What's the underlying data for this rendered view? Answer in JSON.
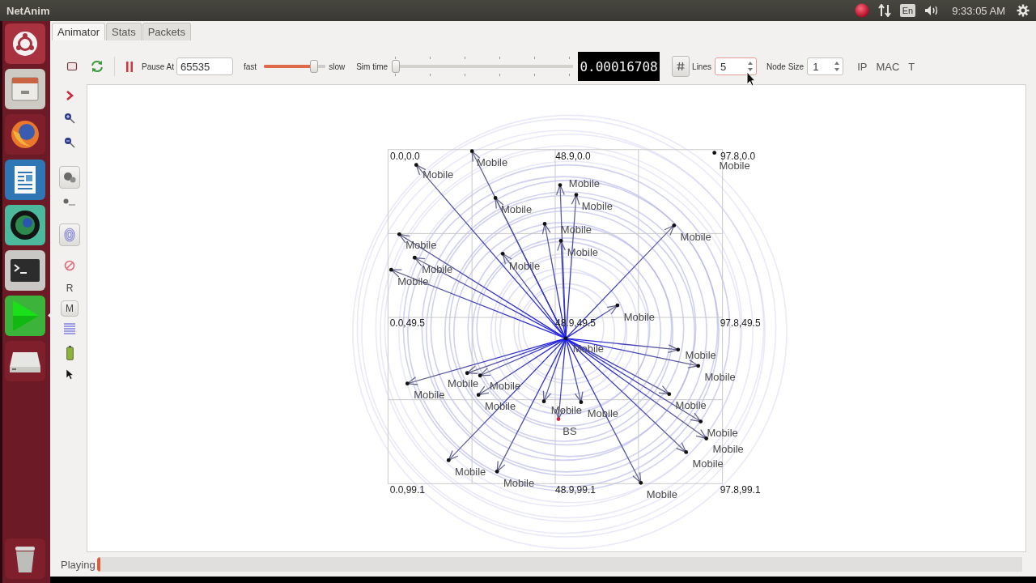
{
  "top_bar": {
    "title": "NetAnim",
    "keyboard": "En",
    "clock": "9:33:05 AM"
  },
  "launcher": [
    {
      "kind": "dash",
      "focused": false
    },
    {
      "kind": "files",
      "focused": false
    },
    {
      "kind": "browser",
      "focused": false
    },
    {
      "kind": "writer",
      "focused": false
    },
    {
      "kind": "sphere",
      "focused": false
    },
    {
      "kind": "terminal",
      "focused": false
    },
    {
      "kind": "player",
      "focused": true
    },
    {
      "kind": "drive",
      "focused": false
    },
    {
      "kind": "trash",
      "focused": false
    }
  ],
  "tabs": [
    {
      "label": "Animator",
      "selected": true
    },
    {
      "label": "Stats",
      "selected": false
    },
    {
      "label": "Packets",
      "selected": false
    }
  ],
  "toolbar": {
    "pause_at_label": "Pause At",
    "pause_at": "65535",
    "fast_label": "fast",
    "speed": {
      "level": 0.82
    },
    "slow_label": "slow",
    "sim_time_label": "Sim time",
    "sim_time": {
      "level": 0.02
    },
    "lcd": "0.00016708",
    "lines_label": "Lines",
    "lines": "5",
    "node_size_label": "Node Size",
    "node_size": "1",
    "buttons": [
      "IP",
      "MAC",
      "T"
    ]
  },
  "side_tools": [
    {
      "kind": "chevron"
    },
    {
      "kind": "zoom_in"
    },
    {
      "kind": "zoom_out"
    },
    {
      "kind": "node_tile"
    },
    {
      "kind": "node_small"
    },
    {
      "kind": "fingerprint_tile"
    },
    {
      "kind": "prohibited"
    },
    {
      "kind": "text",
      "label": "R"
    },
    {
      "kind": "text_tile",
      "label": "M"
    },
    {
      "kind": "lines"
    },
    {
      "kind": "battery"
    },
    {
      "kind": "pointer"
    }
  ],
  "canvas": {
    "grid_labels": [
      "0.0,0.0",
      "48.9,0.0",
      "97.8,0.0",
      "0.0,49.5",
      "48.9,49.5",
      "97.8,49.5",
      "0.0,99.1",
      "48.9,99.1",
      "97.8,99.1"
    ],
    "nodes": [
      {
        "label": "Mobile",
        "kind": "linked",
        "color": "#111111"
      },
      {
        "label": "Mobile",
        "kind": "plain",
        "color": "#111111"
      },
      {
        "label": "Mobile",
        "kind": "linked",
        "color": "#111111"
      },
      {
        "label": "Mobile",
        "kind": "linked",
        "color": "#111111"
      },
      {
        "label": "Mobile",
        "kind": "linked",
        "color": "#111111"
      },
      {
        "label": "Mobile",
        "kind": "linked",
        "color": "#111111"
      },
      {
        "label": "Mobile",
        "kind": "linked",
        "color": "#111111"
      },
      {
        "label": "Mobile",
        "kind": "linked",
        "color": "#111111"
      },
      {
        "label": "Mobile",
        "kind": "linked",
        "color": "#111111"
      },
      {
        "label": "Mobile",
        "kind": "linked",
        "color": "#111111"
      },
      {
        "label": "Mobile",
        "kind": "linked",
        "color": "#111111"
      },
      {
        "label": "Mobile",
        "kind": "linked",
        "color": "#111111"
      },
      {
        "label": "Mobile",
        "kind": "linked",
        "color": "#111111"
      },
      {
        "label": "Mobile",
        "kind": "linked",
        "color": "#111111"
      },
      {
        "label": "Mobile",
        "kind": "plain",
        "color": "#111111"
      },
      {
        "label": "Mobile",
        "kind": "linked",
        "color": "#111111"
      },
      {
        "label": "Mobile",
        "kind": "linked",
        "color": "#111111"
      },
      {
        "label": "Mobile",
        "kind": "linked",
        "color": "#111111"
      },
      {
        "label": "Mobile",
        "kind": "linked",
        "color": "#111111"
      },
      {
        "label": "Mobile",
        "kind": "linked",
        "color": "#111111"
      },
      {
        "label": "Mobile",
        "kind": "linked",
        "color": "#111111"
      },
      {
        "label": "Mobile",
        "kind": "linked",
        "color": "#111111"
      },
      {
        "label": "Mobile",
        "kind": "linked",
        "color": "#111111"
      },
      {
        "label": "Mobile",
        "kind": "linked",
        "color": "#111111"
      },
      {
        "label": "BS",
        "kind": "linked",
        "color": "#cc2244"
      },
      {
        "label": "Mobile",
        "kind": "linked",
        "color": "#111111"
      },
      {
        "label": "Mobile",
        "kind": "linked",
        "color": "#111111"
      },
      {
        "label": "Mobile",
        "kind": "linked",
        "color": "#111111"
      },
      {
        "label": "Mobile",
        "kind": "linked",
        "color": "#111111"
      },
      {
        "label": "Mobile",
        "kind": "linked",
        "color": "#111111"
      },
      {
        "label": "Mobile",
        "kind": "linked",
        "color": "#111111"
      }
    ]
  },
  "status_bar": {
    "text": "Playing",
    "progress": {
      "level": 0.004
    }
  }
}
